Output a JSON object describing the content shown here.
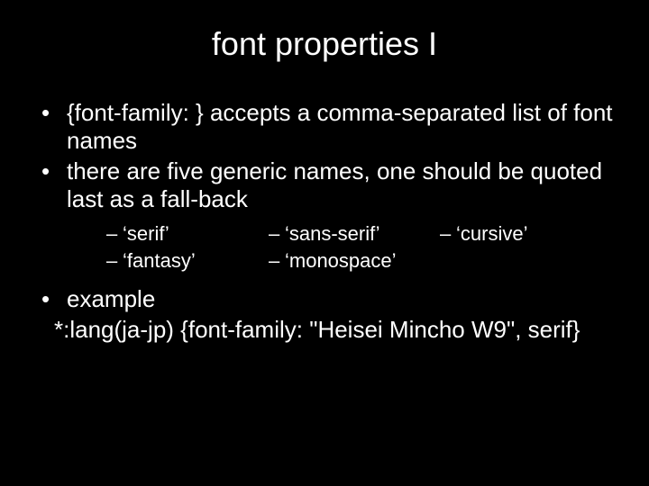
{
  "title": "font properties I",
  "bullets": {
    "b1": "{font-family: } accepts a comma-separated list of font names",
    "b2": "there are five generic names, one should be quoted last as a fall-back",
    "b3": "example",
    "b3code": "*:lang(ja-jp) {font-family: \"Heisei Mincho W9\", serif}"
  },
  "generic_fonts": {
    "col1": {
      "a": "‘serif’",
      "b": "‘fantasy’"
    },
    "col2": {
      "a": "‘sans-serif’",
      "b": "‘monospace’"
    },
    "col3": {
      "a": "‘cursive’"
    }
  }
}
